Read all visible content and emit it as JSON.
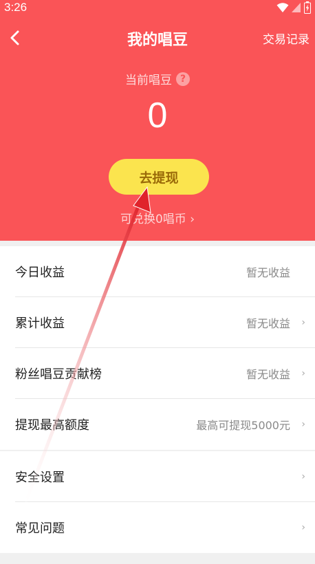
{
  "status": {
    "time": "3:26"
  },
  "nav": {
    "title": "我的唱豆",
    "right_link": "交易记录"
  },
  "balance": {
    "label": "当前唱豆",
    "value": "0"
  },
  "withdraw_button": "去提现",
  "exchange_text": "可兑换0唱币",
  "exchange_chevron": "›",
  "list_1": [
    {
      "label": "今日收益",
      "value": "暂无收益",
      "chevron": ""
    },
    {
      "label": "累计收益",
      "value": "暂无收益",
      "chevron": "›"
    },
    {
      "label": "粉丝唱豆贡献榜",
      "value": "暂无收益",
      "chevron": "›"
    },
    {
      "label": "提现最高额度",
      "value": "最高可提现5000元",
      "chevron": "›"
    }
  ],
  "list_2": [
    {
      "label": "安全设置",
      "chevron": "›"
    },
    {
      "label": "常见问题",
      "chevron": "›"
    }
  ],
  "colors": {
    "header_bg": "#fa5457",
    "button_bg": "#fbe44e",
    "button_text": "#9a6a08",
    "annotation_arrow": "#e0232b"
  },
  "icons": {
    "back": "back-chevron-icon",
    "help": "question-mark-icon",
    "wifi": "wifi-icon",
    "signal": "signal-icon",
    "battery": "battery-icon"
  }
}
